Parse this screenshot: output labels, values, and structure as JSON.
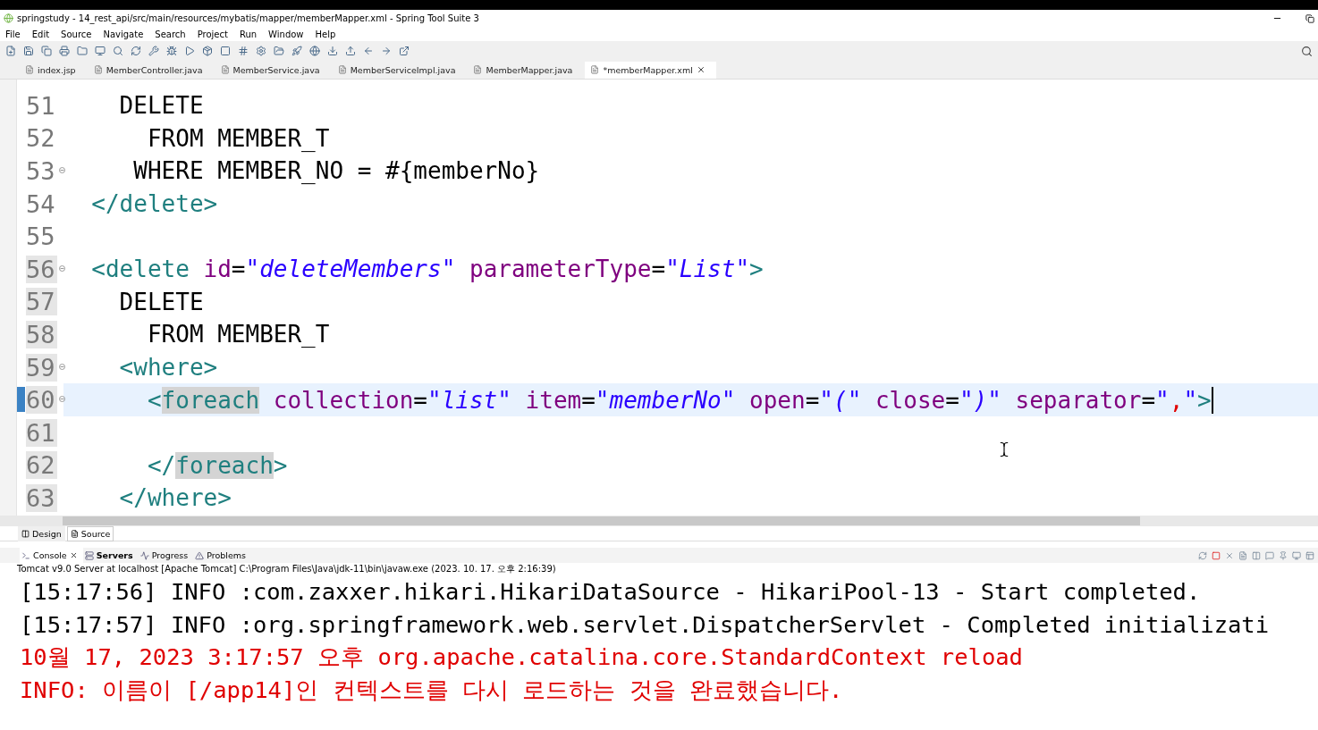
{
  "window": {
    "title": "springstudy - 14_rest_api/src/main/resources/mybatis/mapper/memberMapper.xml - Spring Tool Suite 3"
  },
  "menu": [
    "File",
    "Edit",
    "Source",
    "Navigate",
    "Search",
    "Project",
    "Run",
    "Window",
    "Help"
  ],
  "editor_tabs": [
    {
      "label": "index.jsp",
      "selected": false
    },
    {
      "label": "MemberController.java",
      "selected": false
    },
    {
      "label": "MemberService.java",
      "selected": false
    },
    {
      "label": "MemberServiceImpl.java",
      "selected": false
    },
    {
      "label": "MemberMapper.java",
      "selected": false
    },
    {
      "label": "*memberMapper.xml",
      "selected": true
    }
  ],
  "code_lines": [
    {
      "number": "51",
      "foldable": false,
      "in_range": false,
      "error": false,
      "current": false,
      "tokens": [
        {
          "kind": "plain",
          "text": "    DELETE"
        }
      ]
    },
    {
      "number": "52",
      "foldable": false,
      "in_range": false,
      "error": false,
      "current": false,
      "tokens": [
        {
          "kind": "plain",
          "text": "      FROM MEMBER_T"
        }
      ]
    },
    {
      "number": "53",
      "foldable": true,
      "in_range": false,
      "error": false,
      "current": false,
      "tokens": [
        {
          "kind": "plain",
          "text": "     WHERE MEMBER_NO = #{memberNo}"
        }
      ]
    },
    {
      "number": "54",
      "foldable": false,
      "in_range": false,
      "error": false,
      "current": false,
      "tokens": [
        {
          "kind": "tag",
          "text": "  </delete>"
        }
      ]
    },
    {
      "number": "55",
      "foldable": false,
      "in_range": false,
      "error": false,
      "current": false
    },
    {
      "number": "56",
      "foldable": true,
      "in_range": true,
      "error": false,
      "current": false,
      "tokens": [
        {
          "kind": "tag",
          "text": "  <delete"
        },
        {
          "kind": "attr",
          "text": " id"
        },
        {
          "kind": "plain",
          "text": "="
        },
        {
          "kind": "value",
          "text": "\"deleteMembers\""
        },
        {
          "kind": "attr",
          "text": " parameterType"
        },
        {
          "kind": "plain",
          "text": "="
        },
        {
          "kind": "value",
          "text": "\"List\""
        },
        {
          "kind": "tag",
          "text": ">"
        }
      ]
    },
    {
      "number": "57",
      "foldable": false,
      "in_range": true,
      "error": false,
      "current": false,
      "tokens": [
        {
          "kind": "plain",
          "text": "    DELETE"
        }
      ]
    },
    {
      "number": "58",
      "foldable": false,
      "in_range": true,
      "error": false,
      "current": false,
      "tokens": [
        {
          "kind": "plain",
          "text": "      FROM MEMBER_T"
        }
      ]
    },
    {
      "number": "59",
      "foldable": true,
      "in_range": true,
      "error": false,
      "current": false,
      "tokens": [
        {
          "kind": "tag",
          "text": "    <where>"
        }
      ]
    },
    {
      "number": "60",
      "foldable": true,
      "in_range": true,
      "error": true,
      "current": true,
      "tokens": [
        {
          "kind": "tag",
          "text": "      <"
        },
        {
          "kind": "marked",
          "text": "foreach"
        },
        {
          "kind": "attr",
          "text": " collection"
        },
        {
          "kind": "plain",
          "text": "="
        },
        {
          "kind": "value",
          "text": "\"list\""
        },
        {
          "kind": "attr",
          "text": " item"
        },
        {
          "kind": "plain",
          "text": "="
        },
        {
          "kind": "value",
          "text": "\"memberNo\""
        },
        {
          "kind": "attr",
          "text": " open"
        },
        {
          "kind": "plain",
          "text": "="
        },
        {
          "kind": "value",
          "text": "\"(\""
        },
        {
          "kind": "attr",
          "text": " close"
        },
        {
          "kind": "plain",
          "text": "="
        },
        {
          "kind": "value",
          "text": "\")\""
        },
        {
          "kind": "attr",
          "text": " separator"
        },
        {
          "kind": "plain",
          "text": "="
        },
        {
          "kind": "value",
          "text": "\""
        },
        {
          "kind": "error",
          "text": ","
        },
        {
          "kind": "value",
          "text": "\""
        },
        {
          "kind": "tag",
          "text": ">"
        },
        {
          "kind": "caret"
        }
      ]
    },
    {
      "number": "61",
      "foldable": false,
      "in_range": true,
      "error": false,
      "current": false
    },
    {
      "number": "62",
      "foldable": false,
      "in_range": true,
      "error": false,
      "current": false,
      "tokens": [
        {
          "kind": "tag",
          "text": "      </"
        },
        {
          "kind": "marked",
          "text": "foreach"
        },
        {
          "kind": "tag",
          "text": ">"
        }
      ]
    },
    {
      "number": "63",
      "foldable": false,
      "in_range": true,
      "error": false,
      "current": false,
      "tokens": [
        {
          "kind": "tag",
          "text": "    </where>"
        }
      ]
    }
  ],
  "editor_mode_tabs": [
    {
      "label": "Design",
      "selected": false
    },
    {
      "label": "Source",
      "selected": true
    }
  ],
  "view_tabs": [
    {
      "label": "Console",
      "selected": true,
      "emphasized": false
    },
    {
      "label": "Servers",
      "selected": false,
      "emphasized": true
    },
    {
      "label": "Progress",
      "selected": false,
      "emphasized": false
    },
    {
      "label": "Problems",
      "selected": false,
      "emphasized": false
    }
  ],
  "console": {
    "process": "Tomcat v9.0 Server at localhost [Apache Tomcat] C:\\Program Files\\Java\\jdk-11\\bin\\javaw.exe  (2023. 10. 17. 오후 2:16:39)",
    "lines": [
      {
        "kind": "info",
        "text": "[15:17:56] INFO :com.zaxxer.hikari.HikariDataSource - HikariPool-13 - Start completed."
      },
      {
        "kind": "info",
        "text": "[15:17:57] INFO :org.springframework.web.servlet.DispatcherServlet - Completed initializati"
      },
      {
        "kind": "error",
        "text": "10월 17, 2023 3:17:57 오후 org.apache.catalina.core.StandardContext reload"
      },
      {
        "kind": "error",
        "text": "INFO: 이름이 [/app14]인 컨텍스트를 다시 로드하는 것을 완료했습니다."
      }
    ]
  }
}
